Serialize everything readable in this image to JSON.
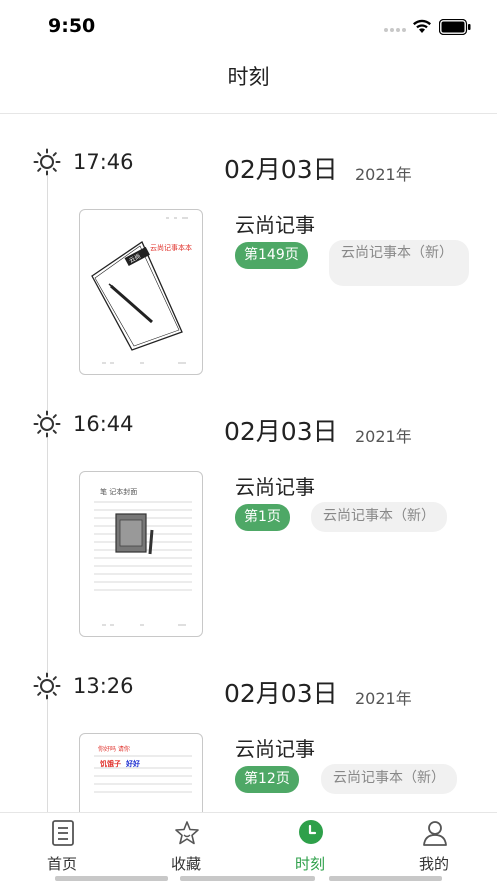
{
  "status": {
    "time": "9:50"
  },
  "header": {
    "title": "时刻"
  },
  "entries": [
    {
      "time": "17:46",
      "date": "02月03日",
      "year": "2021年",
      "title": "云尚记事",
      "page": "第149页",
      "notebook": "云尚记事本（新）"
    },
    {
      "time": "16:44",
      "date": "02月03日",
      "year": "2021年",
      "title": "云尚记事",
      "page": "第1页",
      "notebook": "云尚记事本（新）"
    },
    {
      "time": "13:26",
      "date": "02月03日",
      "year": "2021年",
      "title": "云尚记事",
      "page": "第12页",
      "notebook": "云尚记事本（新）"
    }
  ],
  "thumbnails": {
    "first_note": "云尚记事本本",
    "second_note": "笔  记本封面",
    "third_line1": "你好吗  请你",
    "third_line2_red": "饥饿子",
    "third_line2_blue": "好好"
  },
  "tabs": [
    {
      "label": "首页",
      "icon": "book-icon"
    },
    {
      "label": "收藏",
      "icon": "star-icon"
    },
    {
      "label": "时刻",
      "icon": "clock-icon",
      "active": true
    },
    {
      "label": "我的",
      "icon": "user-icon"
    }
  ],
  "colors": {
    "accent": "#2ea04a",
    "badge": "#4ea866",
    "tag_bg": "#f1f1f1",
    "red_ink": "#e0302a",
    "blue_ink": "#1a2bd0"
  }
}
